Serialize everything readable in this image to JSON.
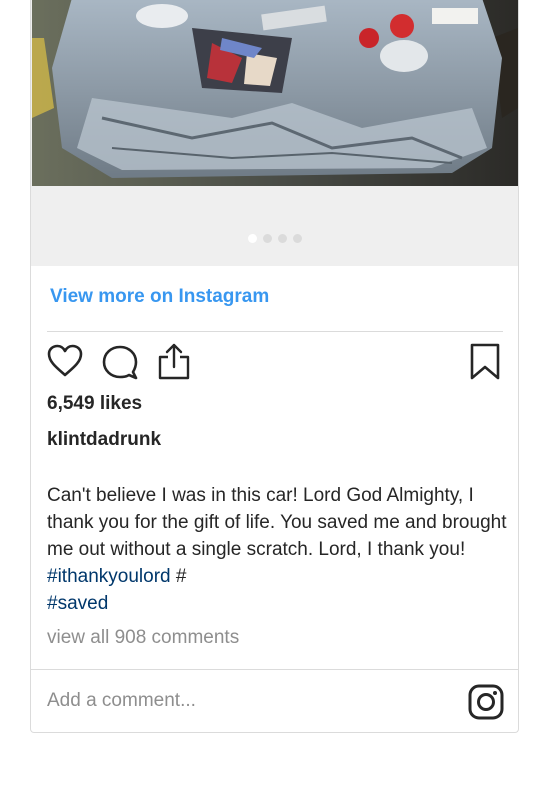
{
  "media": {
    "image_alt": "Damaged silver car rear",
    "slide_count": 4,
    "active_slide": 1
  },
  "view_more_label": "View more on Instagram",
  "actions": {
    "like_icon": "heart-icon",
    "comment_icon": "comment-icon",
    "share_icon": "share-icon",
    "save_icon": "bookmark-icon"
  },
  "likes": "6,549 likes",
  "username": "klintdadrunk",
  "caption": {
    "text": "Can't believe I was in this car! Lord God Almighty, I thank you for the gift of life. You saved me and brought me out without a single scratch. Lord, I thank you! ",
    "hashtag_1": "#ithankyoulord",
    "separator": " #",
    "hashtag_2": "#saved"
  },
  "view_comments": "view all 908 comments",
  "comment_box": {
    "placeholder": "Add a comment...",
    "value": ""
  },
  "brand_icon": "instagram-icon",
  "colors": {
    "link_blue": "#3897f0",
    "hashtag_blue": "#00376b",
    "muted_gray": "#8e8e8e",
    "border": "#dbdbdb"
  }
}
